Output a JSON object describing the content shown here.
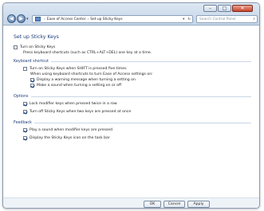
{
  "window": {
    "controls": {
      "minimize": "–",
      "maximize": "□",
      "close": "✕"
    }
  },
  "nav": {
    "back_icon": "back-arrow-icon",
    "forward_icon": "forward-arrow-icon",
    "dropdown_glyph": "▾"
  },
  "address": {
    "crumbs": [
      "Ease of Access Center",
      "Set up Sticky Keys"
    ],
    "separator": "›",
    "dropdown_glyph": "▾",
    "refresh_glyph": "↻"
  },
  "search": {
    "placeholder": "Search Control Panel",
    "icon": "search-icon"
  },
  "page": {
    "title": "Set up Sticky Keys",
    "turn_on": {
      "label": "Turn on Sticky Keys",
      "checked": false
    },
    "turn_on_help": "Press keyboard shortcuts (such as CTRL+ALT+DEL) one key at a time.",
    "sections": {
      "keyboard_shortcut": "Keyboard shortcut",
      "options": "Options",
      "feedback": "Feedback"
    },
    "shortcut": {
      "shift_five": {
        "label": "Turn on Sticky Keys when SHIFT is pressed five times",
        "checked": false
      },
      "when_using": "When using keyboard shortcuts to turn Ease of Access settings on:",
      "warning_msg": {
        "label": "Display a warning message when turning a setting on",
        "checked": true
      },
      "sound_on_off": {
        "label": "Make a sound when turning a setting on or off",
        "checked": true
      }
    },
    "options": {
      "lock_modifier": {
        "label": "Lock modifier keys when pressed twice in a row",
        "checked": true
      },
      "turn_off_two": {
        "label": "Turn off Sticky Keys when two keys are pressed at once",
        "checked": true
      }
    },
    "feedback": {
      "play_sound": {
        "label": "Play a sound when modifier keys are pressed",
        "checked": true
      },
      "display_icon": {
        "label": "Display the Sticky Keys icon on the task bar",
        "checked": true
      }
    }
  },
  "buttons": {
    "ok": "OK",
    "cancel": "Cancel",
    "apply": "Apply"
  }
}
